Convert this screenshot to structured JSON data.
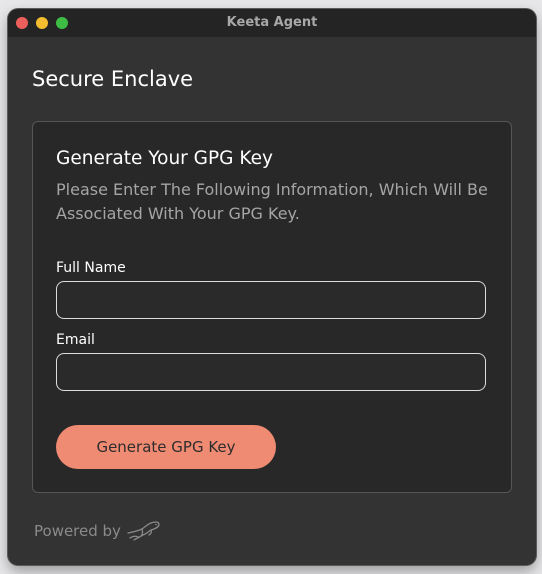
{
  "window": {
    "title": "Keeta Agent"
  },
  "page": {
    "title": "Secure Enclave"
  },
  "card": {
    "title": "Generate Your GPG Key",
    "description": "Please Enter The Following Information, Which Will Be Associated With Your GPG Key.",
    "fields": [
      {
        "label": "Full Name",
        "value": "",
        "placeholder": ""
      },
      {
        "label": "Email",
        "value": "",
        "placeholder": ""
      }
    ],
    "button_label": "Generate GPG Key"
  },
  "footer": {
    "powered_label": "Powered by",
    "logo_icon": "keeta-logo-icon"
  },
  "colors": {
    "accent": "#ef8a73",
    "window_bg": "#333333",
    "card_bg": "#282828"
  }
}
